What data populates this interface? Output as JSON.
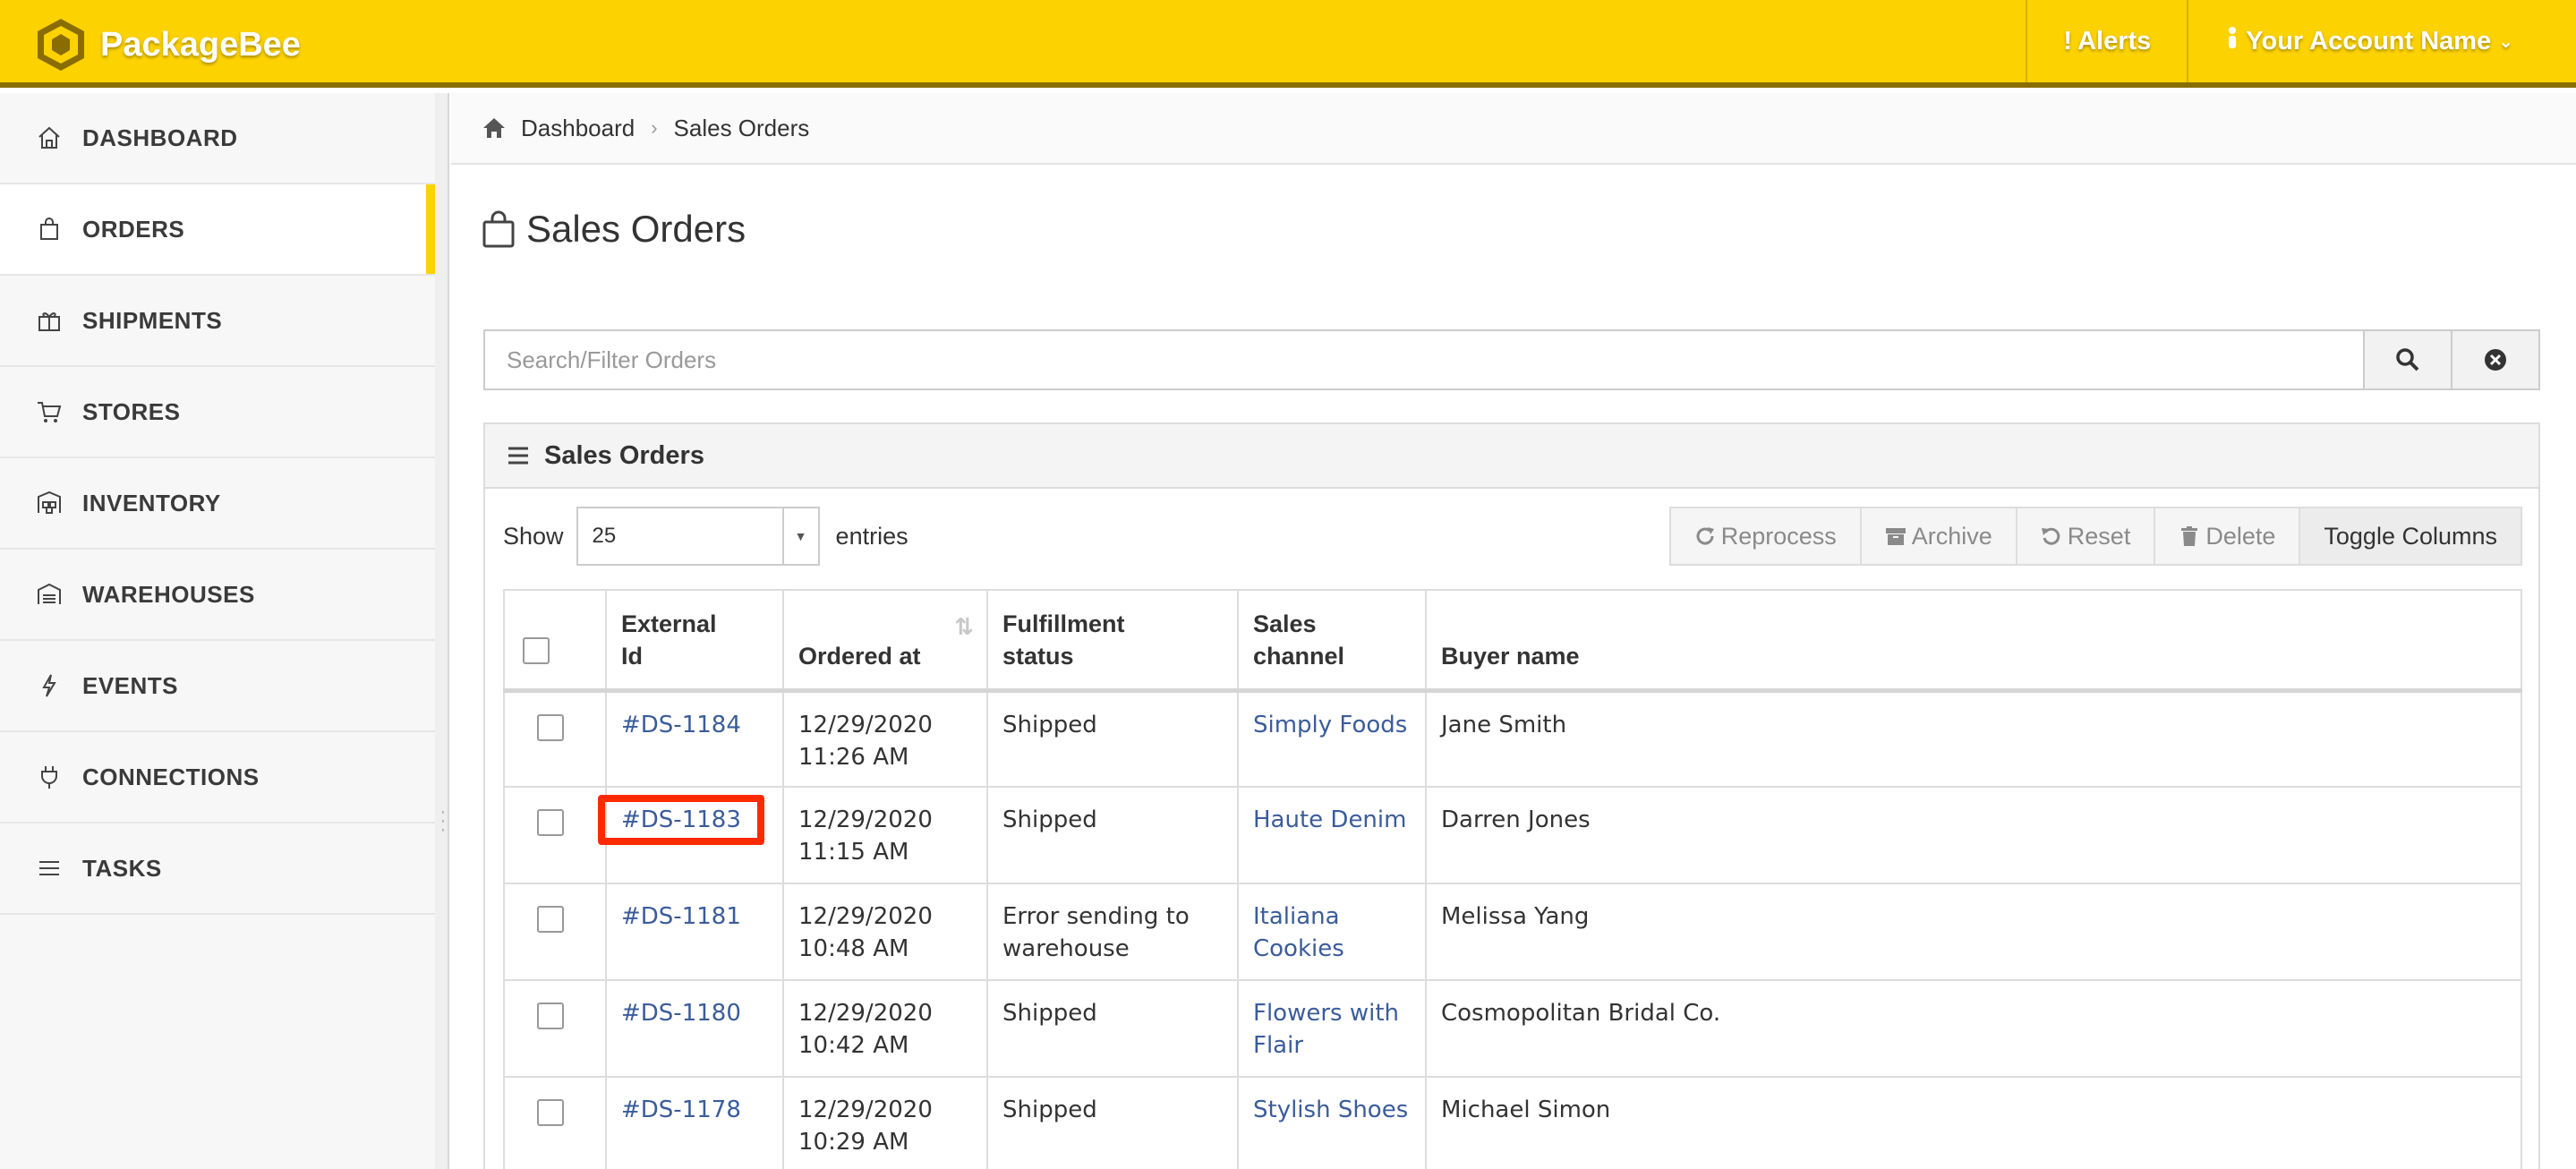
{
  "app": {
    "name": "PackageBee"
  },
  "topbar": {
    "alerts_label": "Alerts",
    "account_label": "Your Account Name"
  },
  "sidebar": {
    "items": [
      {
        "label": "DASHBOARD",
        "icon": "home-icon"
      },
      {
        "label": "ORDERS",
        "icon": "shopping-bag-icon",
        "active": true
      },
      {
        "label": "SHIPMENTS",
        "icon": "gift-box-icon"
      },
      {
        "label": "STORES",
        "icon": "cart-icon"
      },
      {
        "label": "INVENTORY",
        "icon": "warehouse-shelves-icon"
      },
      {
        "label": "WAREHOUSES",
        "icon": "warehouse-icon"
      },
      {
        "label": "EVENTS",
        "icon": "lightning-icon"
      },
      {
        "label": "CONNECTIONS",
        "icon": "plug-icon"
      },
      {
        "label": "TASKS",
        "icon": "list-icon"
      }
    ]
  },
  "breadcrumb": {
    "home": "Dashboard",
    "current": "Sales Orders"
  },
  "page": {
    "title": "Sales Orders"
  },
  "search": {
    "placeholder": "Search/Filter Orders",
    "value": ""
  },
  "panel": {
    "title": "Sales Orders"
  },
  "length_control": {
    "show_label": "Show",
    "value": "25",
    "entries_label": "entries"
  },
  "toolbar": {
    "reprocess": "Reprocess",
    "archive": "Archive",
    "reset": "Reset",
    "delete": "Delete",
    "toggle_columns": "Toggle Columns"
  },
  "table": {
    "headers": {
      "external_id": [
        "External",
        "Id"
      ],
      "ordered_at": "Ordered at",
      "fulfillment_status": [
        "Fulfillment",
        "status"
      ],
      "sales_channel": [
        "Sales",
        "channel"
      ],
      "buyer_name": "Buyer name"
    },
    "rows": [
      {
        "id": "#DS-1184",
        "date": "12/29/2020",
        "time": "11:26 AM",
        "status": [
          "Shipped",
          ""
        ],
        "channel": [
          "Simply Foods",
          ""
        ],
        "buyer": "Jane Smith"
      },
      {
        "id": "#DS-1183",
        "date": "12/29/2020",
        "time": "11:15 AM",
        "status": [
          "Shipped",
          ""
        ],
        "channel": [
          "Haute Denim",
          ""
        ],
        "buyer": "Darren Jones",
        "highlighted": true
      },
      {
        "id": "#DS-1181",
        "date": "12/29/2020",
        "time": "10:48 AM",
        "status": [
          "Error sending to",
          "warehouse"
        ],
        "channel": [
          "Italiana",
          "Cookies"
        ],
        "buyer": "Melissa Yang"
      },
      {
        "id": "#DS-1180",
        "date": "12/29/2020",
        "time": "10:42 AM",
        "status": [
          "Shipped",
          ""
        ],
        "channel": [
          "Flowers with",
          "Flair"
        ],
        "buyer": "Cosmopolitan Bridal Co."
      },
      {
        "id": "#DS-1178",
        "date": "12/29/2020",
        "time": "10:29 AM",
        "status": [
          "Shipped",
          ""
        ],
        "channel": [
          "Stylish Shoes",
          ""
        ],
        "buyer": "Michael Simon"
      }
    ]
  },
  "colors": {
    "brand": "#fcd200",
    "link": "#3b5c9a",
    "highlight": "#ff2a00"
  }
}
